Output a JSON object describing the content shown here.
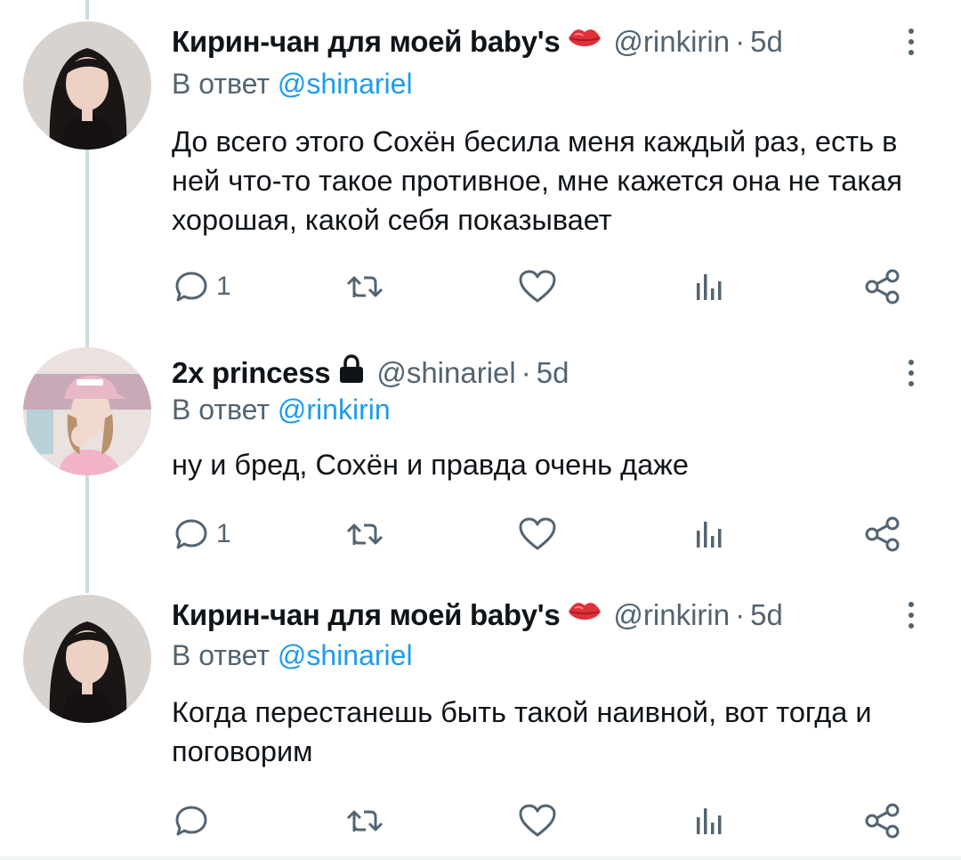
{
  "reply_prefix": "В ответ",
  "tweets": [
    {
      "display_name": "Кирин-чан для моей baby's",
      "badge_icon": "lips-emoji",
      "handle": "@rinkirin",
      "separator": "·",
      "time": "5d",
      "reply_to": "@shinariel",
      "text": "До всего этого Сохён бесила меня каждый раз, есть в ней что-то такое противное, мне кажется она не такая хорошая, какой себя показывает",
      "reply_count": "1"
    },
    {
      "display_name": "2x princess",
      "badge_icon": "lock-icon",
      "handle": "@shinariel",
      "separator": "·",
      "time": "5d",
      "reply_to": "@rinkirin",
      "text": "ну и бред, Сохён и правда очень даже",
      "reply_count": "1"
    },
    {
      "display_name": "Кирин-чан для моей baby's",
      "badge_icon": "lips-emoji",
      "handle": "@rinkirin",
      "separator": "·",
      "time": "5d",
      "reply_to": "@shinariel",
      "text": "Когда перестанешь быть такой наивной, вот тогда и поговорим",
      "reply_count": ""
    }
  ],
  "colors": {
    "link": "#1d9bf0",
    "muted": "#536471",
    "text": "#0f1419",
    "thread_line": "#cfd9de",
    "lips": "#e0303a"
  }
}
